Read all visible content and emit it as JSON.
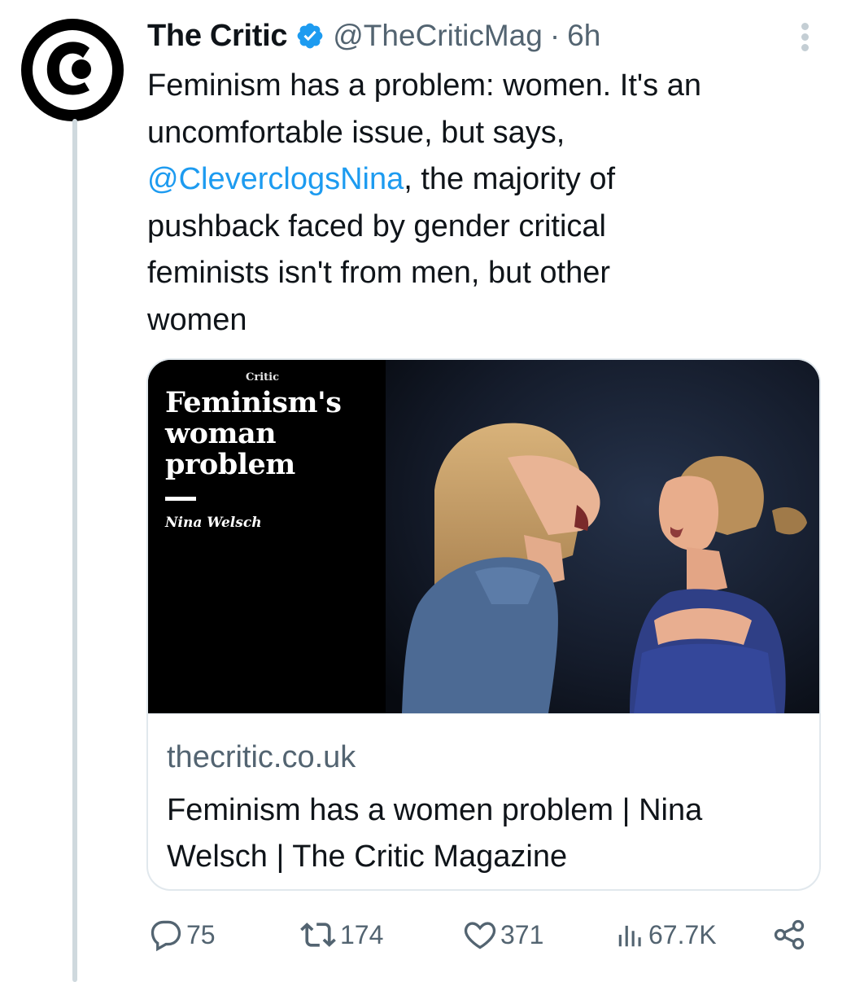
{
  "tweet": {
    "author_name": "The Critic",
    "handle": "@TheCriticMag",
    "separator": "·",
    "time": "6h",
    "text_before_mention": "Feminism has a problem: women. It's an\nuncomfortable issue, but says,\n",
    "mention": "@CleverclogsNina",
    "text_after_mention": ", the majority of\npushback faced by gender critical\nfeminists isn't from men, but other\nwomen"
  },
  "card": {
    "image": {
      "logo_text": "Critic",
      "headline": "Feminism's\nwoman\nproblem",
      "author": "Nina Welsch"
    },
    "domain": "thecritic.co.uk",
    "title": "Feminism has a women problem | Nina Welsch | The Critic Magazine"
  },
  "actions": {
    "replies": "75",
    "retweets": "174",
    "likes": "371",
    "views": "67.7K"
  },
  "icons": {
    "avatar": "the-critic-logo-icon",
    "verified": "verified-badge-icon",
    "more": "more-vertical-icon",
    "reply": "reply-icon",
    "retweet": "retweet-icon",
    "like": "heart-icon",
    "views": "views-chart-icon",
    "share": "share-icon"
  },
  "colors": {
    "accent": "#1d9bf0",
    "secondary_text": "#536471",
    "text": "#0f1419"
  }
}
